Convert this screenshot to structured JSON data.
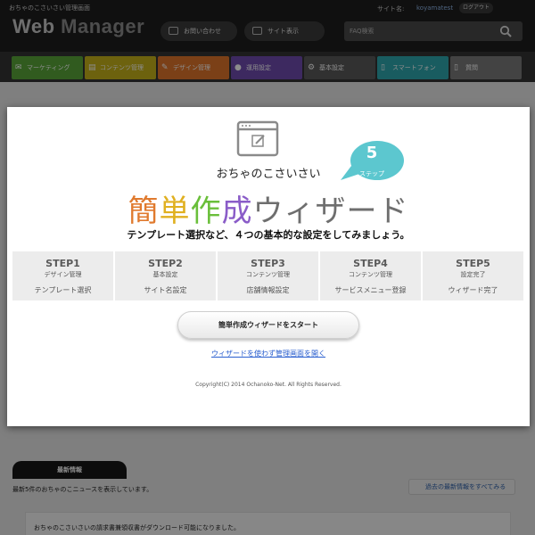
{
  "header": {
    "tagline": "おちゃのこさいさい管理画面",
    "logo_part1": "Web",
    "logo_part2": "Manager",
    "site_label": "サイト名:",
    "site_name": "koyamatest",
    "logout": "ログアウト",
    "contact_button": "お問い合わせ",
    "view_site_button": "サイト表示",
    "search_placeholder": "FAQ検索"
  },
  "nav": {
    "items": [
      {
        "label": "マーケティング",
        "color": "#5aa63a",
        "glyph": "✉"
      },
      {
        "label": "コンテンツ管理",
        "color": "#c6b21a",
        "glyph": "▤"
      },
      {
        "label": "デザイン管理",
        "color": "#e0762a",
        "glyph": "✎"
      },
      {
        "label": "運用設定",
        "color": "#6f4cb0",
        "glyph": "●"
      },
      {
        "label": "基本設定",
        "color": "#5a5a5a",
        "glyph": "⚙"
      },
      {
        "label": "スマートフォン",
        "color": "#2fa8b0",
        "glyph": "▯"
      },
      {
        "label": "質問",
        "color": "#7a7a7a",
        "glyph": "▯"
      }
    ]
  },
  "news": {
    "tab_label": "最新情報",
    "description": "最新5件のおちゃのこニュースを表示しています。",
    "view_all": "過去の最新情報をすべてみる",
    "item_text": "おちゃのこさいさいの請求書兼領収書がダウンロード可能になりました。"
  },
  "modal": {
    "brand_sub": "おちゃのこさいさい",
    "bubble_number": "5",
    "bubble_label": "ステップ",
    "bubble_color": "#5cc7cf",
    "title_chars": [
      {
        "ch": "簡",
        "color": "#e07a2e"
      },
      {
        "ch": "単",
        "color": "#e0b020"
      },
      {
        "ch": "作",
        "color": "#6abf3a"
      },
      {
        "ch": "成",
        "color": "#8a5cc8"
      },
      {
        "ch": "ウィザード",
        "color": "#6e6e6e"
      }
    ],
    "lead": "テンプレート選択など、４つの基本的な設定をしてみましょう。",
    "steps": [
      {
        "no": "STEP1",
        "category": "デザイン管理",
        "task": "テンプレート選択"
      },
      {
        "no": "STEP2",
        "category": "基本設定",
        "task": "サイト名設定"
      },
      {
        "no": "STEP3",
        "category": "コンテンツ管理",
        "task": "店舗情報設定"
      },
      {
        "no": "STEP4",
        "category": "コンテンツ管理",
        "task": "サービスメニュー登録"
      },
      {
        "no": "STEP5",
        "category": "設定完了",
        "task": "ウィザード完了"
      }
    ],
    "start_button": "簡単作成ウィザードをスタート",
    "skip_link": "ウィザードを使わず管理画面を開く",
    "copyright": "Copyright(C) 2014 Ochanoko-Net. All Rights Reserved."
  }
}
